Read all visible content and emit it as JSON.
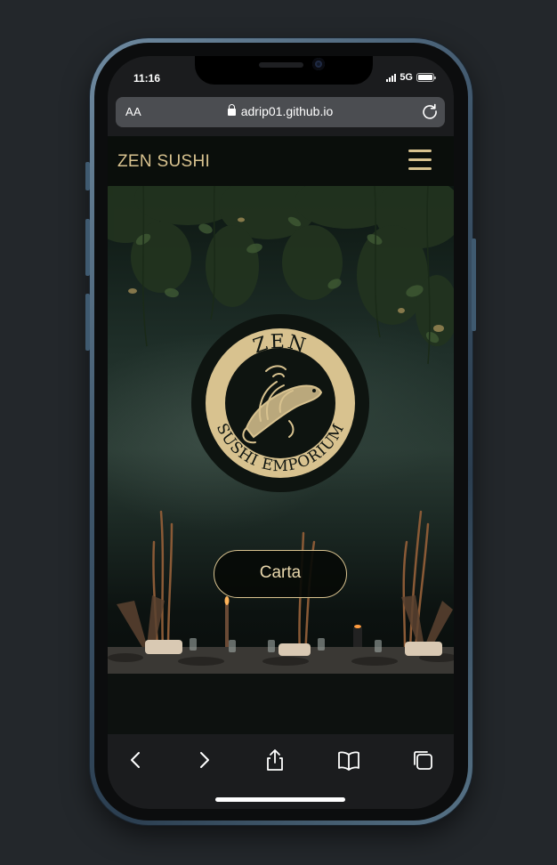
{
  "status_bar": {
    "time": "11:16",
    "network": "5G",
    "battery_level": 1.0
  },
  "browser": {
    "aa_label": "AA",
    "url": "adrip01.github.io"
  },
  "site": {
    "brand": "ZEN SUSHI",
    "accent_color": "#d8c28f",
    "logo": {
      "top_text": "ZEN",
      "bottom_text": "SUSHI EMPORIUM",
      "emblem": "koi-fish-icon"
    },
    "hero_button_label": "Carta"
  },
  "toolbar_icons": [
    "back-icon",
    "forward-icon",
    "share-icon",
    "bookmarks-icon",
    "tabs-icon"
  ]
}
